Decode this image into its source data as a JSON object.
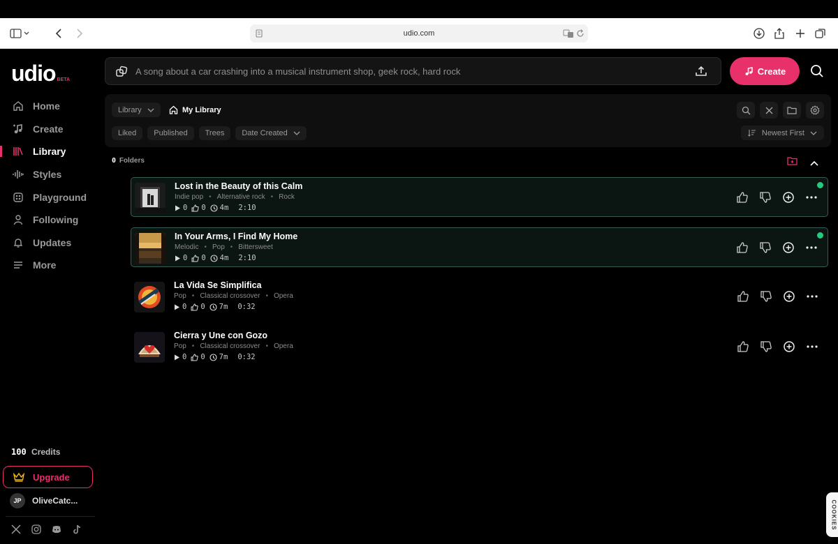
{
  "browser": {
    "url": "udio.com"
  },
  "brand": {
    "logo_text": "udio",
    "badge": "BETA",
    "accent": "#e8306b"
  },
  "sidebar": {
    "items": [
      {
        "label": "Home",
        "icon": "home-icon"
      },
      {
        "label": "Create",
        "icon": "music-note-icon"
      },
      {
        "label": "Library",
        "icon": "library-icon"
      },
      {
        "label": "Styles",
        "icon": "waveform-icon"
      },
      {
        "label": "Playground",
        "icon": "playground-icon"
      },
      {
        "label": "Following",
        "icon": "user-icon"
      },
      {
        "label": "Updates",
        "icon": "bell-icon"
      },
      {
        "label": "More",
        "icon": "menu-icon"
      }
    ],
    "credits_value": "100",
    "credits_label": "Credits",
    "upgrade_label": "Upgrade",
    "user_initials": "JP",
    "user_name": "OliveCatc..."
  },
  "prompt": {
    "placeholder": "A song about a car crashing into a musical instrument shop, geek rock, hard rock",
    "create_label": "Create"
  },
  "library": {
    "crumb_library": "Library",
    "crumb_my_library": "My Library",
    "filters": [
      "Liked",
      "Published",
      "Trees",
      "Date Created"
    ],
    "sort_label": "Newest First",
    "folders_count": "0",
    "folders_label": "Folders"
  },
  "songs": [
    {
      "title": "Lost in the Beauty of this Calm",
      "tags": [
        "Indie pop",
        "Alternative rock",
        "Rock"
      ],
      "plays": "0",
      "likes": "0",
      "age": "4m",
      "duration": "2:10",
      "selected": true,
      "live": true
    },
    {
      "title": "In Your Arms, I Find My Home",
      "tags": [
        "Melodic",
        "Pop",
        "Bittersweet"
      ],
      "plays": "0",
      "likes": "0",
      "age": "4m",
      "duration": "2:10",
      "selected": true,
      "live": true
    },
    {
      "title": "La Vida Se Simplifica",
      "tags": [
        "Pop",
        "Classical crossover",
        "Opera"
      ],
      "plays": "0",
      "likes": "0",
      "age": "7m",
      "duration": "0:32",
      "selected": false,
      "live": false
    },
    {
      "title": "Cierra y Une con Gozo",
      "tags": [
        "Pop",
        "Classical crossover",
        "Opera"
      ],
      "plays": "0",
      "likes": "0",
      "age": "7m",
      "duration": "0:32",
      "selected": false,
      "live": false
    }
  ],
  "cookies_label": "COOKIES"
}
